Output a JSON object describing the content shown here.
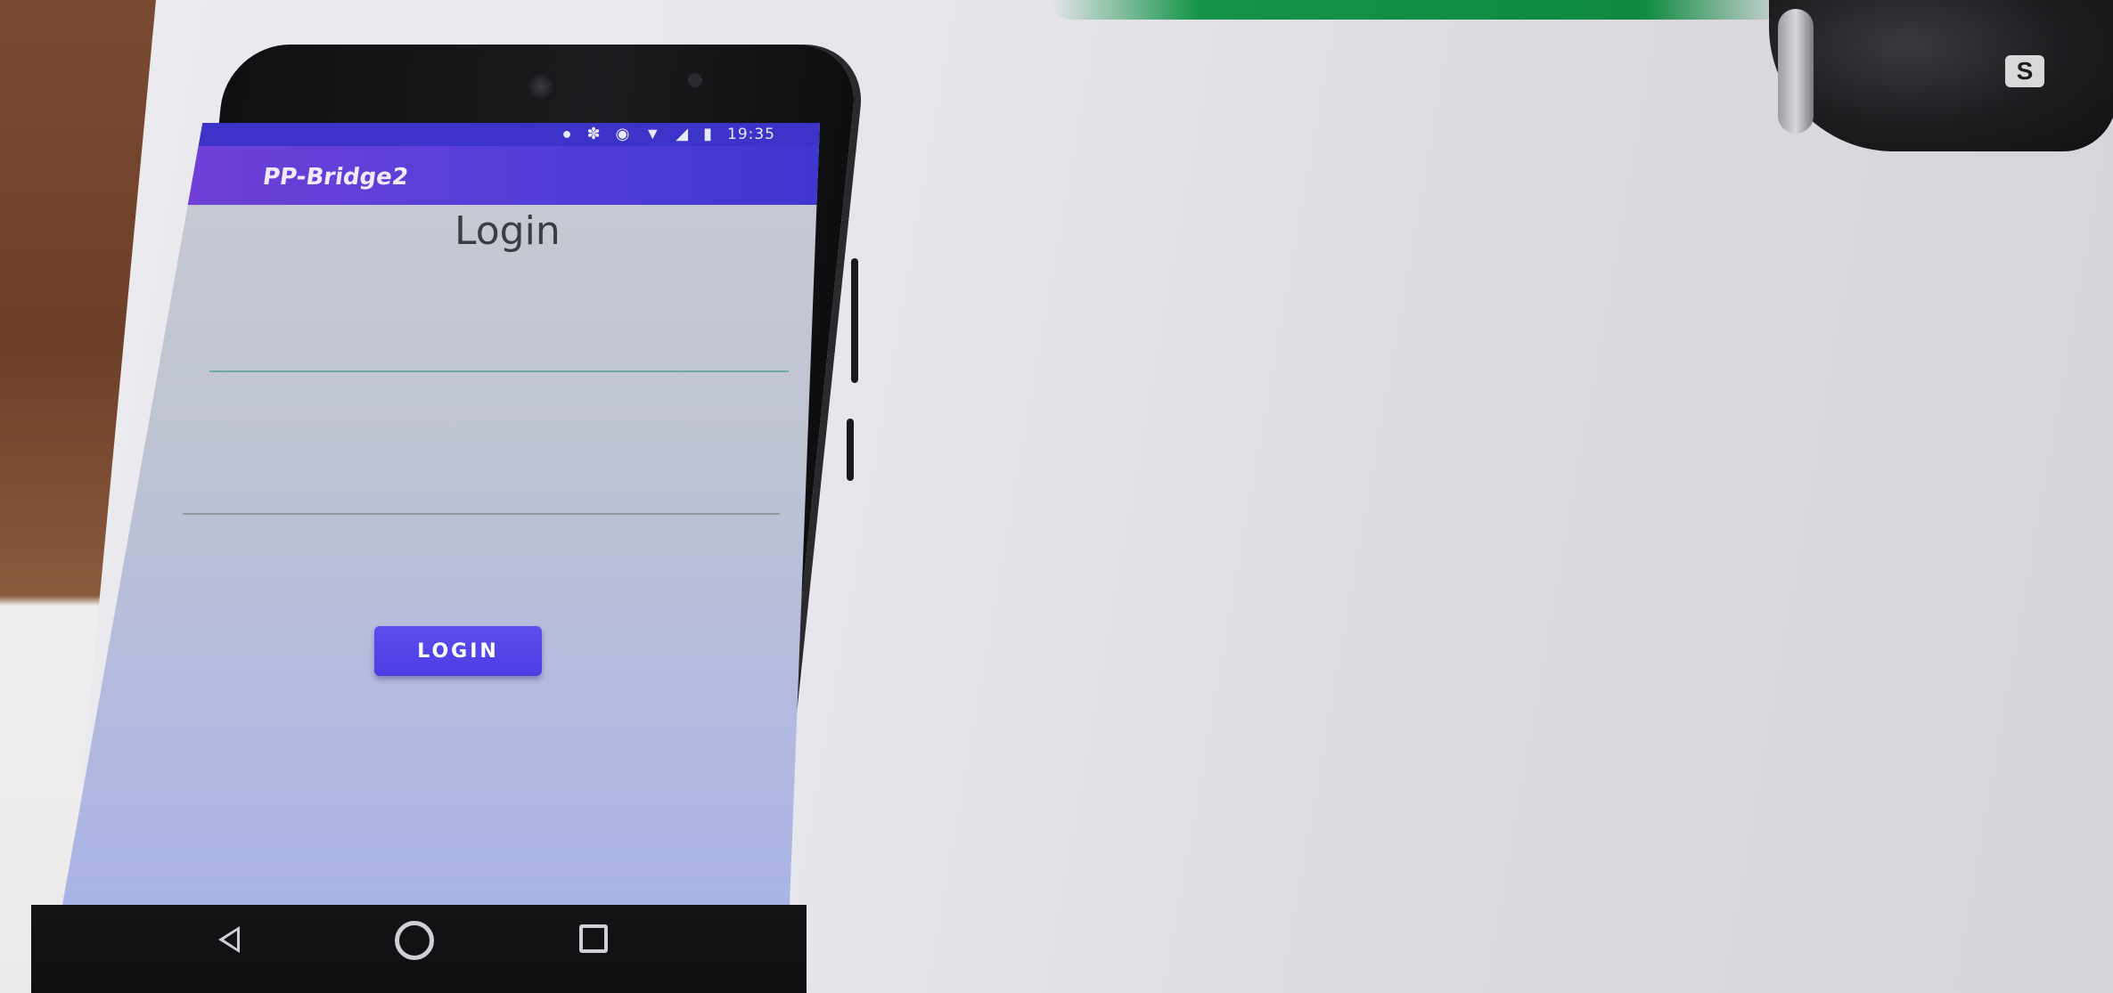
{
  "status_bar": {
    "icons": [
      "location-icon",
      "bluetooth-icon",
      "message-icon",
      "wifi-icon",
      "signal-icon",
      "battery-icon"
    ],
    "time": "19:35"
  },
  "app_bar": {
    "title": "PP-Bridge2"
  },
  "login_screen": {
    "heading": "Login",
    "username_value": "",
    "password_value": "",
    "login_button_label": "LOGIN"
  },
  "navigation_bar": {
    "icons": [
      "back-icon",
      "home-icon",
      "recents-icon"
    ]
  },
  "watch": {
    "logo_text": "S"
  },
  "colors": {
    "status_bar": "#3c33c9",
    "app_bar": "#5a3fd8",
    "login_button": "#4c3de3",
    "field_underline": "#6fa7a6"
  }
}
